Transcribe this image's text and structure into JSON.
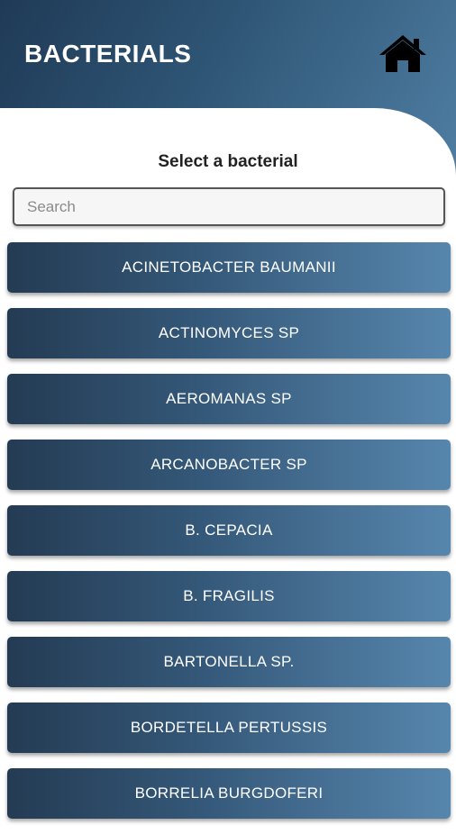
{
  "header": {
    "title": "BACTERIALS",
    "home_icon": "home-icon"
  },
  "main": {
    "subtitle": "Select a bacterial",
    "search": {
      "placeholder": "Search",
      "value": ""
    },
    "items": [
      {
        "label": "ACINETOBACTER BAUMANII"
      },
      {
        "label": "ACTINOMYCES SP"
      },
      {
        "label": "AEROMANAS SP"
      },
      {
        "label": "ARCANOBACTER SP"
      },
      {
        "label": "B. CEPACIA"
      },
      {
        "label": "B. FRAGILIS"
      },
      {
        "label": "BARTONELLA SP."
      },
      {
        "label": "BORDETELLA PERTUSSIS"
      },
      {
        "label": "BORRELIA BURGDOFERI"
      }
    ]
  },
  "colors": {
    "header_gradient_start": "#1f3a56",
    "header_gradient_end": "#4f7ea3",
    "item_gradient_start": "#243b53",
    "item_gradient_end": "#5786ad"
  }
}
